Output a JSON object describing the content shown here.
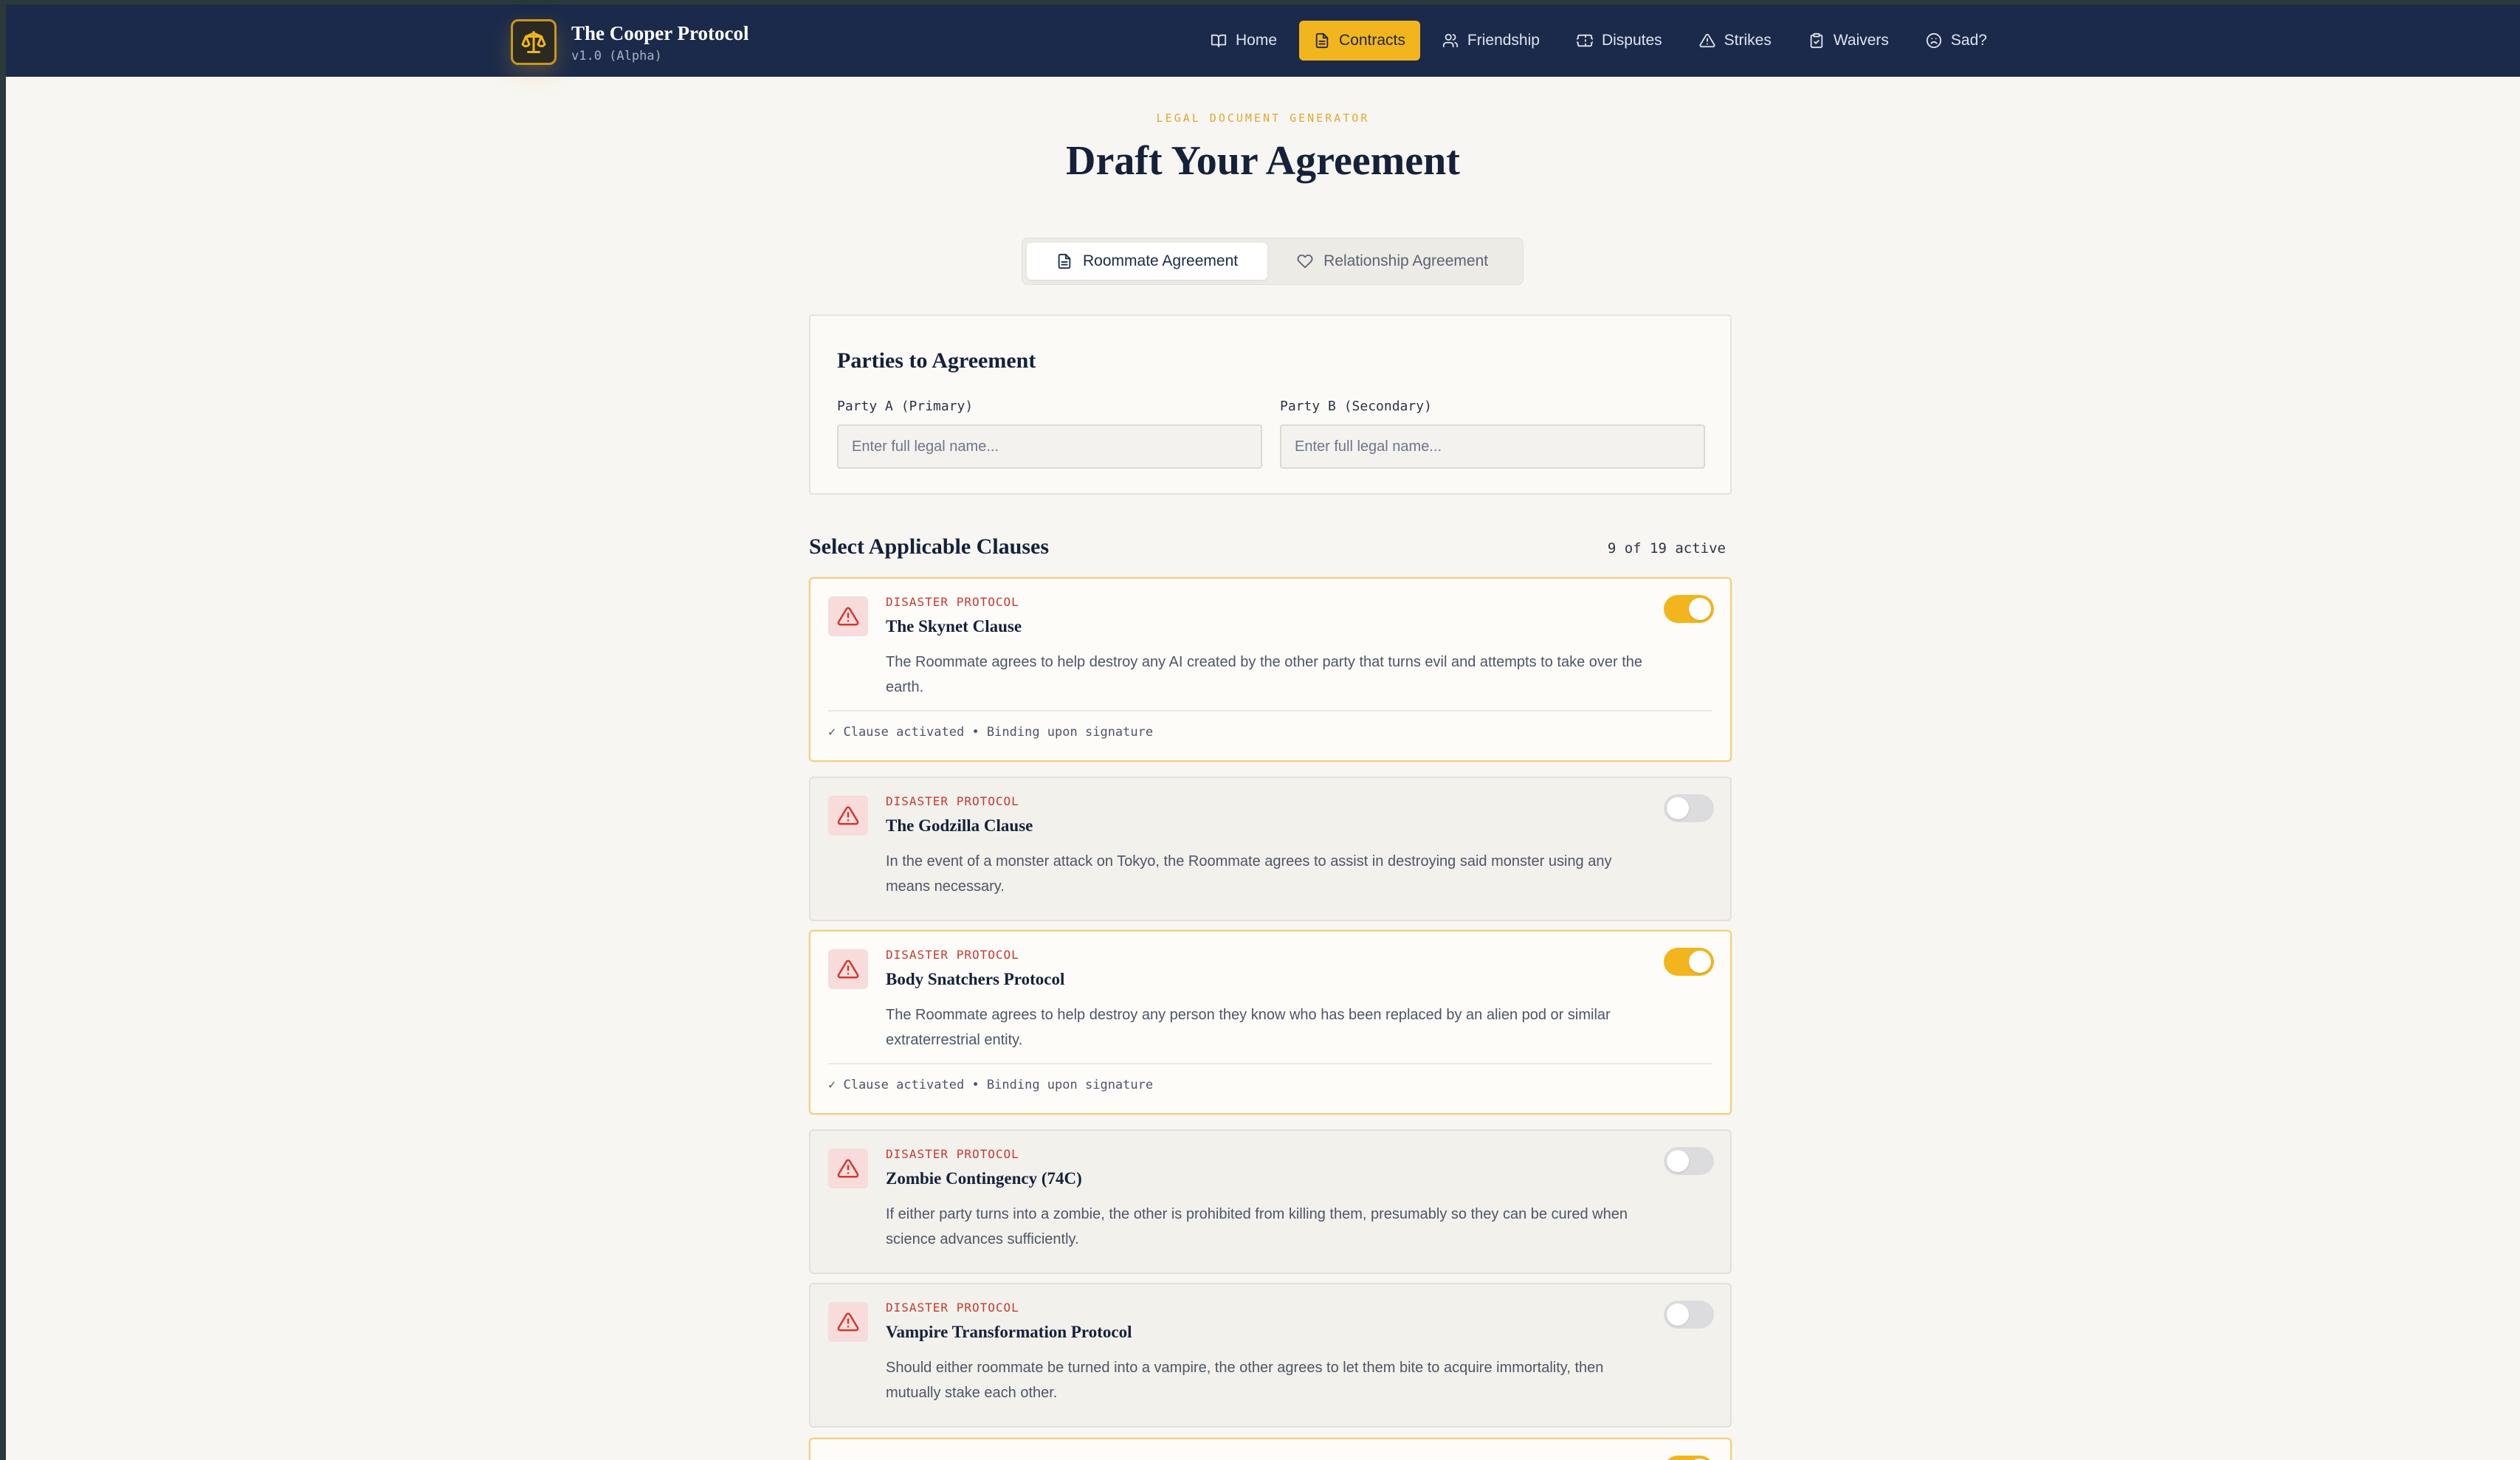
{
  "app": {
    "title": "The Cooper Protocol",
    "version": "v1.0 (Alpha)",
    "accent_color": "#f2b51d",
    "nav_bg": "#1b2a4a"
  },
  "nav": [
    {
      "label": "Home",
      "icon": "book-icon"
    },
    {
      "label": "Contracts",
      "icon": "document-icon",
      "active": true
    },
    {
      "label": "Friendship",
      "icon": "users-icon"
    },
    {
      "label": "Disputes",
      "icon": "ticket-icon"
    },
    {
      "label": "Strikes",
      "icon": "warning-icon"
    },
    {
      "label": "Waivers",
      "icon": "clipboard-check-icon"
    },
    {
      "label": "Sad?",
      "icon": "frown-icon"
    }
  ],
  "header": {
    "eyebrow": "LEGAL DOCUMENT GENERATOR",
    "title": "Draft Your Agreement"
  },
  "tabs": [
    {
      "label": "Roommate Agreement",
      "icon": "document-icon",
      "active": true
    },
    {
      "label": "Relationship Agreement",
      "icon": "heart-icon",
      "active": false
    }
  ],
  "parties": {
    "title": "Parties to Agreement",
    "party_a": {
      "label": "Party A (Primary)",
      "placeholder": "Enter full legal name...",
      "value": ""
    },
    "party_b": {
      "label": "Party B (Secondary)",
      "placeholder": "Enter full legal name...",
      "value": ""
    }
  },
  "clauses_section": {
    "title": "Select Applicable Clauses",
    "active_count": "9 of 19 active"
  },
  "clauses": [
    {
      "category": "DISASTER PROTOCOL",
      "name": "The Skynet Clause",
      "description": "The Roommate agrees to help destroy any AI created by the other party that turns evil and attempts to take over the earth.",
      "active": true,
      "status": "✓ Clause activated • Binding upon signature"
    },
    {
      "category": "DISASTER PROTOCOL",
      "name": "The Godzilla Clause",
      "description": "In the event of a monster attack on Tokyo, the Roommate agrees to assist in destroying said monster using any means necessary.",
      "active": false
    },
    {
      "category": "DISASTER PROTOCOL",
      "name": "Body Snatchers Protocol",
      "description": "The Roommate agrees to help destroy any person they know who has been replaced by an alien pod or similar extraterrestrial entity.",
      "active": true,
      "status": "✓ Clause activated • Binding upon signature"
    },
    {
      "category": "DISASTER PROTOCOL",
      "name": "Zombie Contingency (74C)",
      "description": "If either party turns into a zombie, the other is prohibited from killing them, presumably so they can be cured when science advances sufficiently.",
      "active": false
    },
    {
      "category": "DISASTER PROTOCOL",
      "name": "Vampire Transformation Protocol",
      "description": "Should either roommate be turned into a vampire, the other agrees to let them bite to acquire immortality, then mutually stake each other.",
      "active": false
    },
    {
      "category": "",
      "name": "",
      "description": "",
      "active": true
    }
  ]
}
